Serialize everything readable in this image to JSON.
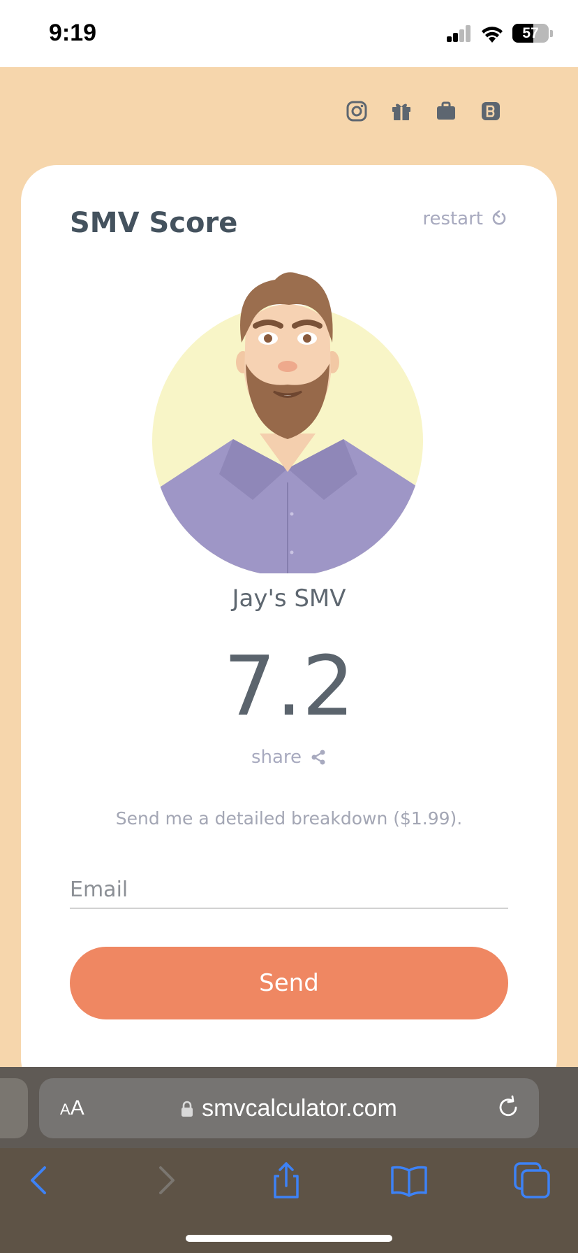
{
  "status_bar": {
    "time": "9:19",
    "battery_level": "57",
    "battery_fraction": 0.57
  },
  "social_icons": [
    "instagram-icon",
    "gift-icon",
    "briefcase-icon",
    "blogger-icon"
  ],
  "card": {
    "title": "SMV Score",
    "restart_label": "restart",
    "name_label": "Jay's SMV",
    "score": "7.2",
    "share_label": "share",
    "breakdown_text": "Send me a detailed breakdown ($1.99).",
    "email_placeholder": "Email",
    "send_label": "Send"
  },
  "browser": {
    "aa_small": "A",
    "aa_large": "A",
    "url": "smvcalculator.com"
  },
  "colors": {
    "page_background": "#f6d6ac",
    "title": "#44525e",
    "muted": "#a8aabf",
    "send_button": "#ef8762",
    "ios_blue": "#3d82f6"
  }
}
